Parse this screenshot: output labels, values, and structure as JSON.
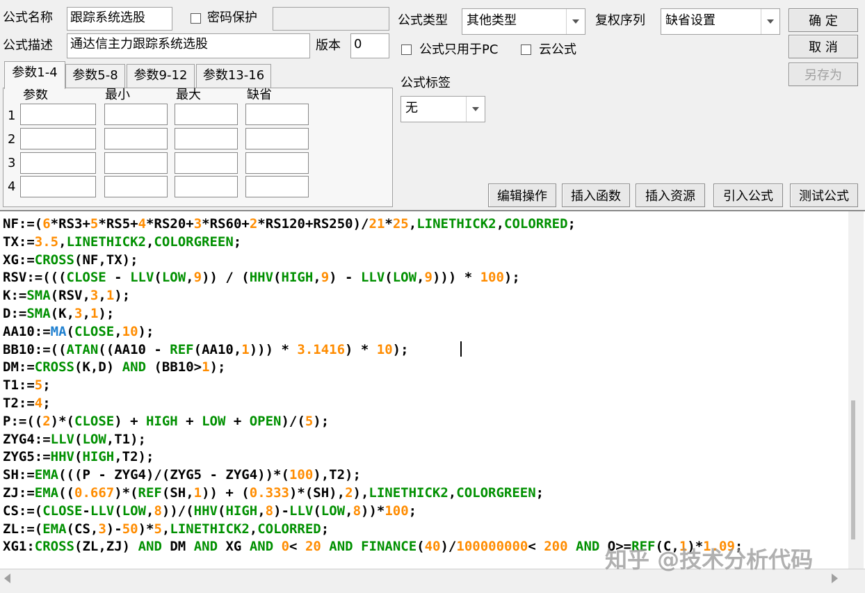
{
  "formula": {
    "name_label": "公式名称",
    "name_value": "跟踪系统选股",
    "password_label": "密码保护",
    "password_value": "",
    "desc_label": "公式描述",
    "desc_value": "通达信主力跟踪系统选股",
    "version_label": "版本",
    "version_value": "0",
    "type_label": "公式类型",
    "type_value": "其他类型",
    "adjust_label": "复权序列",
    "adjust_value": "缺省设置",
    "pc_only_label": "公式只用于PC",
    "cloud_label": "云公式",
    "tag_label": "公式标签",
    "tag_value": "无"
  },
  "buttons": {
    "ok": "确  定",
    "cancel": "取  消",
    "save_as": "另存为",
    "edit_ops": "编辑操作",
    "insert_func": "插入函数",
    "insert_res": "插入资源",
    "import_formula": "引入公式",
    "test_formula": "测试公式"
  },
  "tabs": [
    "参数1-4",
    "参数5-8",
    "参数9-12",
    "参数13-16"
  ],
  "params": {
    "headers": [
      "参数",
      "最小",
      "最大",
      "缺省"
    ],
    "rows": [
      "1",
      "2",
      "3",
      "4"
    ]
  },
  "code_lines": [
    "NF:=(6*RS3+5*RS5+4*RS20+3*RS60+2*RS120+RS250)/21*25,LINETHICK2,COLORRED;",
    "TX:=3.5,LINETHICK2,COLORGREEN;",
    "XG:=CROSS(NF,TX);",
    "RSV:=(((CLOSE - LLV(LOW,9)) / (HHV(HIGH,9) - LLV(LOW,9))) * 100);",
    "K:=SMA(RSV,3,1);",
    "D:=SMA(K,3,1);",
    "AA10:=MA(CLOSE,10);",
    "BB10:=((ATAN((AA10 - REF(AA10,1))) * 3.1416) * 10);",
    "DM:=CROSS(K,D) AND (BB10>1);",
    "T1:=5;",
    "T2:=4;",
    "P:=((2)*(CLOSE) + HIGH + LOW + OPEN)/(5);",
    "ZYG4:=LLV(LOW,T1);",
    "ZYG5:=HHV(HIGH,T2);",
    "SH:=EMA(((P - ZYG4)/(ZYG5 - ZYG4))*(100),T2);",
    "ZJ:=EMA((0.667)*(REF(SH,1)) + (0.333)*(SH),2),LINETHICK2,COLORGREEN;",
    "CS:=(CLOSE-LLV(LOW,8))/(HHV(HIGH,8)-LLV(LOW,8))*100;",
    "ZL:=(EMA(CS,3)-50)*5,LINETHICK2,COLORRED;",
    "XG1:CROSS(ZL,ZJ) AND DM AND XG AND 0< 20 AND FINANCE(40)/100000000< 200 AND O>=REF(C,1)*1.09;"
  ],
  "watermark": "知乎 @技术分析代码",
  "colors": {
    "keyword": "#009000",
    "number": "#ff8c00",
    "ma": "#2080d0"
  }
}
